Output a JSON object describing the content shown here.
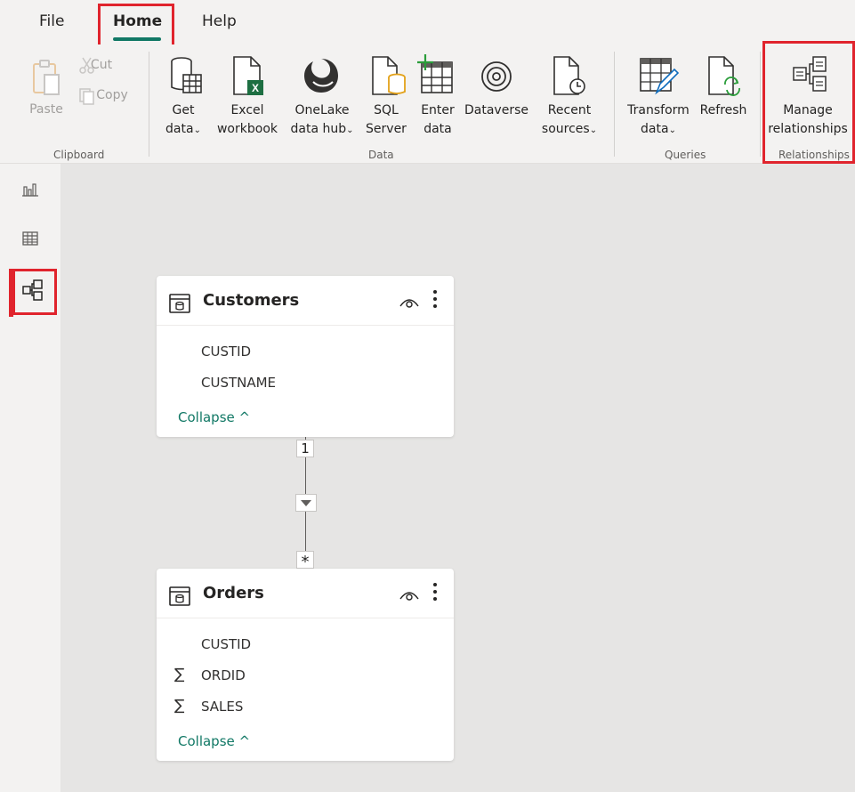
{
  "menu": {
    "file": "File",
    "home": "Home",
    "help": "Help"
  },
  "ribbon": {
    "clipboard": {
      "paste": "Paste",
      "cut": "Cut",
      "copy": "Copy",
      "group": "Clipboard"
    },
    "data": {
      "get_data": [
        "Get",
        "data"
      ],
      "excel": [
        "Excel",
        "workbook"
      ],
      "onelake": [
        "OneLake",
        "data hub"
      ],
      "sql": [
        "SQL",
        "Server"
      ],
      "enter": [
        "Enter",
        "data"
      ],
      "dataverse": "Dataverse",
      "recent": [
        "Recent",
        "sources"
      ],
      "group": "Data"
    },
    "queries": {
      "transform": [
        "Transform",
        "data"
      ],
      "refresh": "Refresh",
      "group": "Queries"
    },
    "relationships": {
      "manage": [
        "Manage",
        "relationships"
      ],
      "group": "Relationships"
    },
    "chevron": "⌄"
  },
  "model": {
    "customers": {
      "title": "Customers",
      "fields": [
        "CUSTID",
        "CUSTNAME"
      ],
      "collapse": "Collapse ^"
    },
    "orders": {
      "title": "Orders",
      "fields": [
        "CUSTID",
        "ORDID",
        "SALES"
      ],
      "collapse": "Collapse ^"
    },
    "relationship": {
      "one": "1",
      "many": "*"
    },
    "sigma": "∑"
  },
  "colors": {
    "accent": "#117865",
    "highlight": "#e0242d",
    "canvas": "#e6e5e4"
  }
}
